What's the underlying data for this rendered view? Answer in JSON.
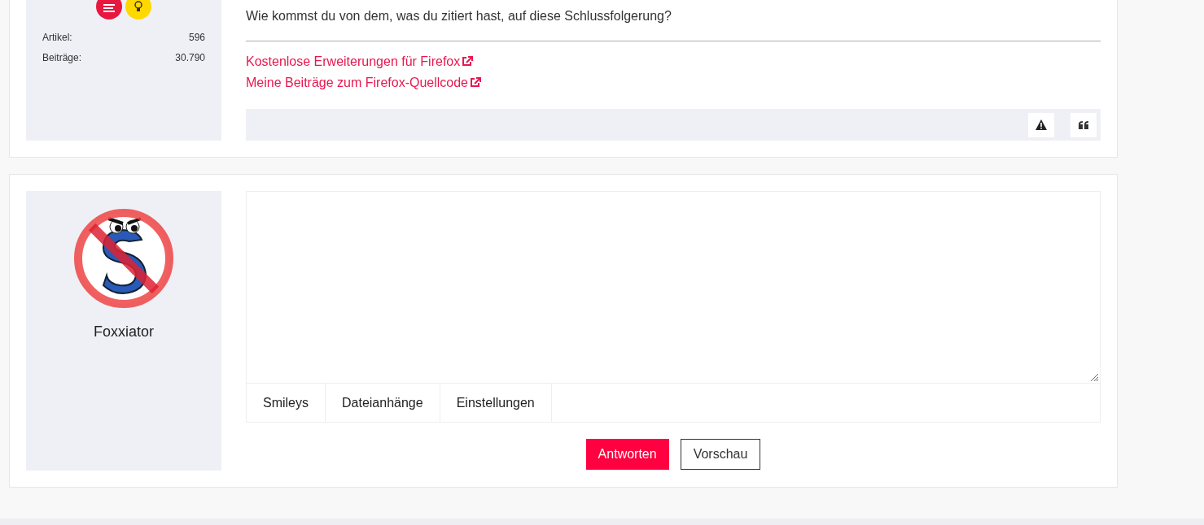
{
  "previous_post": {
    "stats": [
      {
        "label": "Artikel:",
        "value": "596"
      },
      {
        "label": "Beiträge:",
        "value": "30.790"
      }
    ],
    "message": "Wie kommst du von dem, was du zitiert hast, auf diese Schlussfolgerung?",
    "signature_links": [
      "Kostenlose Erweiterungen für Firefox",
      "Meine Beiträge zum Firefox-Quellcode"
    ]
  },
  "reply": {
    "username": "Foxxiator",
    "tabs": [
      {
        "label": "Smileys",
        "selected": false
      },
      {
        "label": "Dateianhänge",
        "selected": false
      },
      {
        "label": "Einstellungen",
        "selected": false
      }
    ],
    "buttons": [
      {
        "label": "Antworten",
        "kind": "primary"
      },
      {
        "label": "Vorschau",
        "kind": "secondary"
      }
    ]
  }
}
